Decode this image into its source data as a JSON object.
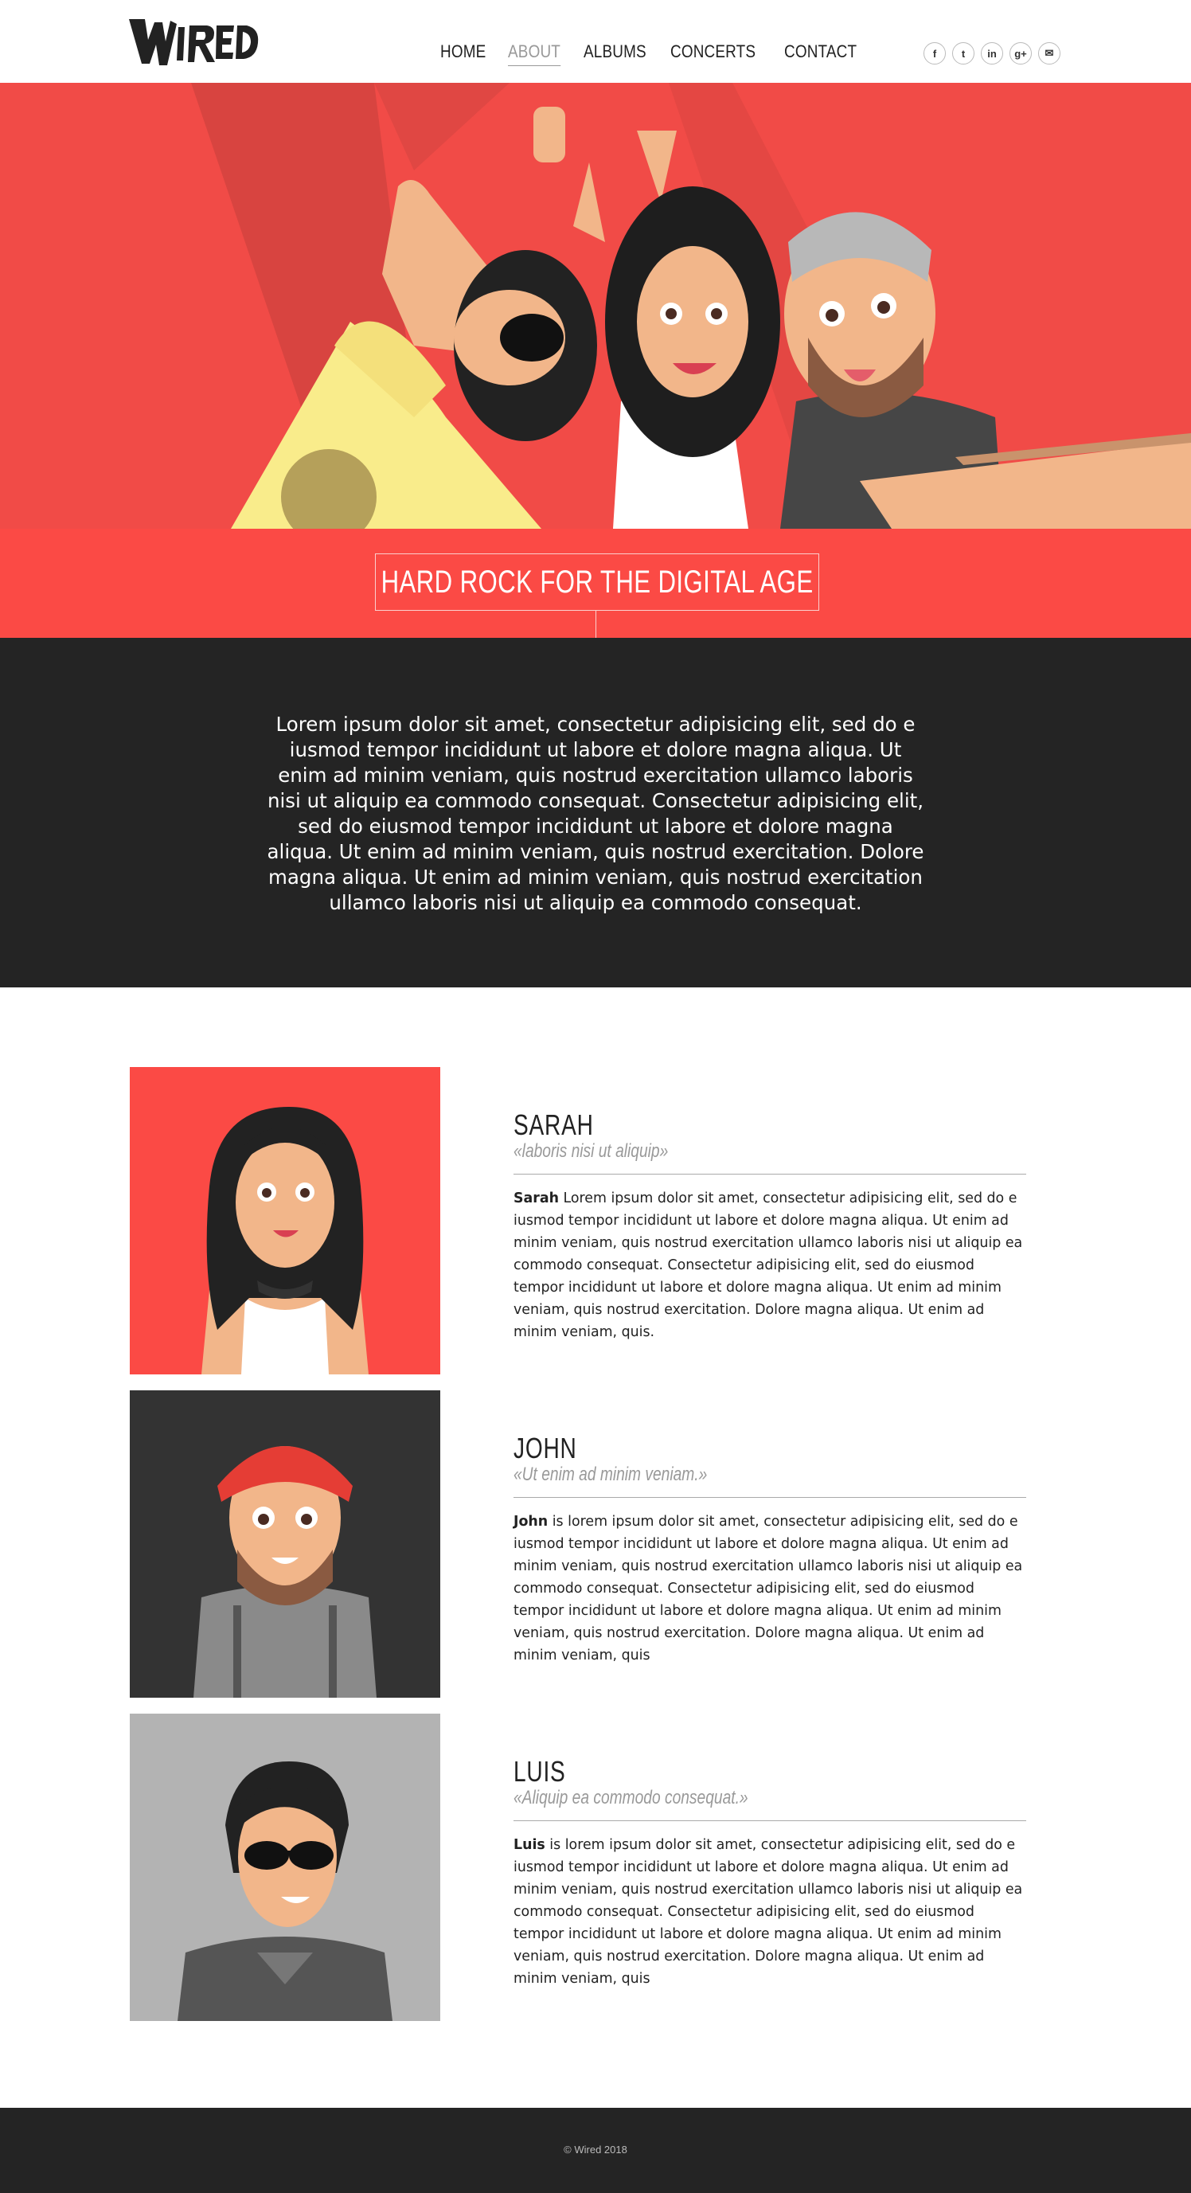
{
  "brand": {
    "logo_text": "WIRED"
  },
  "nav": {
    "items": [
      {
        "label": "HOME",
        "active": false
      },
      {
        "label": "ABOUT",
        "active": true
      },
      {
        "label": "ALBUMS",
        "active": false
      },
      {
        "label": "CONCERTS",
        "active": false
      },
      {
        "label": "CONTACT",
        "active": false
      }
    ]
  },
  "social": [
    {
      "icon": "facebook-icon",
      "glyph": "f"
    },
    {
      "icon": "twitter-icon",
      "glyph": "t"
    },
    {
      "icon": "linkedin-icon",
      "glyph": "in"
    },
    {
      "icon": "googleplus-icon",
      "glyph": "g+"
    },
    {
      "icon": "email-icon",
      "glyph": "✉"
    }
  ],
  "hero": {
    "title": "HARD ROCK FOR THE DIGITAL AGE"
  },
  "intro": {
    "text": "Lorem ipsum dolor sit amet, consectetur adipisicing elit, sed do e iusmod tempor incididunt ut labore et dolore magna aliqua. Ut enim ad minim veniam, quis nostrud exercitation ullamco laboris nisi ut aliquip ea commodo consequat. Consectetur adipisicing elit, sed do eiusmod tempor incididunt ut labore et dolore magna aliqua. Ut enim ad minim veniam, quis nostrud exercitation. Dolore magna aliqua. Ut enim ad minim veniam, quis nostrud exercitation ullamco laboris nisi ut aliquip ea commodo consequat."
  },
  "members": [
    {
      "name": "SARAH",
      "quote": "«laboris nisi ut aliquip»",
      "bio_name": "Sarah",
      "bio": " Lorem ipsum dolor sit amet, consectetur adipisicing elit, sed do e iusmod tempor incididunt ut labore et dolore magna aliqua. Ut enim ad minim veniam, quis nostrud exercitation ullamco laboris nisi ut aliquip ea commodo consequat. Consectetur adipisicing elit, sed do eiusmod tempor incididunt ut labore et dolore magna aliqua. Ut enim ad minim veniam, quis nostrud exercitation. Dolore magna aliqua. Ut enim ad minim veniam, quis."
    },
    {
      "name": "JOHN",
      "quote": "«Ut enim ad minim veniam.»",
      "bio_name": "John",
      "bio": " is lorem ipsum dolor sit amet, consectetur adipisicing elit, sed do e iusmod tempor incididunt ut labore et dolore magna aliqua. Ut enim ad minim veniam, quis nostrud exercitation ullamco laboris nisi ut aliquip ea commodo consequat. Consectetur adipisicing elit, sed do eiusmod tempor incididunt ut labore et dolore magna aliqua. Ut enim ad minim veniam, quis nostrud exercitation. Dolore magna aliqua. Ut enim ad minim veniam, quis"
    },
    {
      "name": "LUIS",
      "quote": "«Aliquip ea commodo consequat.»",
      "bio_name": "Luis",
      "bio": " is lorem ipsum dolor sit amet, consectetur adipisicing elit, sed do e iusmod tempor incididunt ut labore et dolore magna aliqua. Ut enim ad minim veniam, quis nostrud exercitation ullamco laboris nisi ut aliquip ea commodo consequat. Consectetur adipisicing elit, sed do eiusmod tempor incididunt ut labore et dolore magna aliqua. Ut enim ad minim veniam, quis nostrud exercitation. Dolore magna aliqua. Ut enim ad minim veniam, quis"
    }
  ],
  "footer": {
    "copyright": "© Wired 2018"
  },
  "colors": {
    "accent": "#fb4a45",
    "dark": "#242424",
    "portrait_sarah": "#fb4a45",
    "portrait_john": "#333333",
    "portrait_luis": "#b3b3b3"
  }
}
